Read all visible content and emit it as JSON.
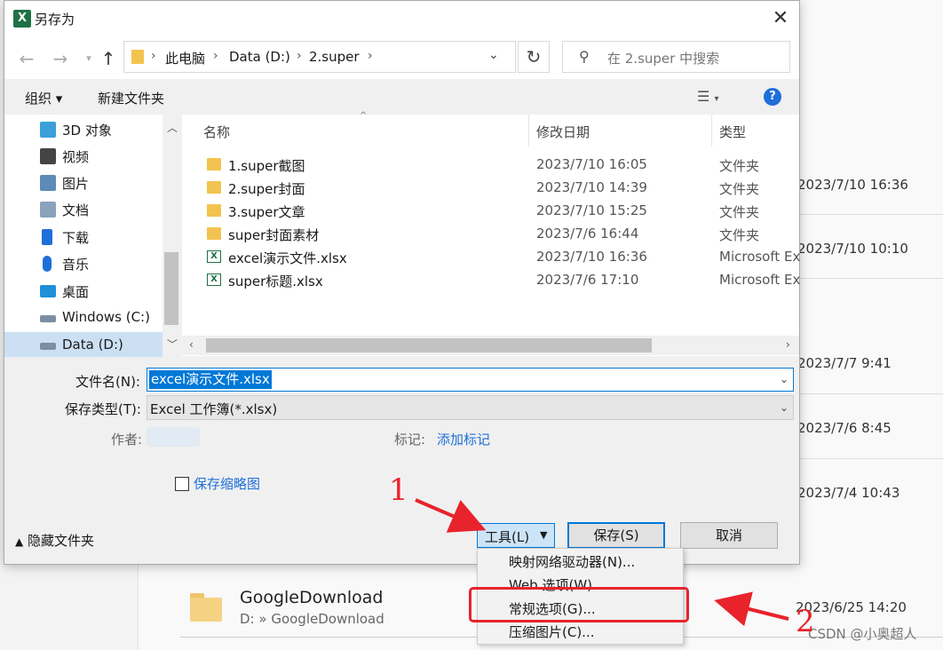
{
  "background": {
    "dates": [
      "2023/7/10 16:36",
      "2023/7/10 10:10",
      "2023/7/7 9:41",
      "2023/7/6 8:45",
      "2023/7/4 10:43"
    ],
    "folder": {
      "name": "GoogleDownload",
      "path": "D: » GoogleDownload",
      "date": "2023/6/25 14:20"
    },
    "watermark": "CSDN @小奥超人"
  },
  "dialog": {
    "title": "另存为",
    "title_icon": "X",
    "breadcrumb": [
      "此电脑",
      "Data (D:)",
      "2.super"
    ],
    "search_placeholder": "在 2.super 中搜索",
    "organize_label": "组织 ▾",
    "new_folder_label": "新建文件夹",
    "help_label": "?",
    "nav_items": [
      {
        "label": "3D 对象",
        "icon": "3d-objects-icon",
        "color": "#3aa0d8"
      },
      {
        "label": "视频",
        "icon": "video-icon",
        "color": "#444444"
      },
      {
        "label": "图片",
        "icon": "pictures-icon",
        "color": "#5d8ab6"
      },
      {
        "label": "文档",
        "icon": "documents-icon",
        "color": "#8aa2bb"
      },
      {
        "label": "下载",
        "icon": "downloads-icon",
        "color": "#1e6fd9"
      },
      {
        "label": "音乐",
        "icon": "music-icon",
        "color": "#1e6fd9"
      },
      {
        "label": "桌面",
        "icon": "desktop-icon",
        "color": "#1e90d9"
      },
      {
        "label": "Windows (C:)",
        "icon": "drive-c-icon",
        "color": "#7a8fa3"
      },
      {
        "label": "Data (D:)",
        "icon": "drive-d-icon",
        "color": "#7a8fa3"
      }
    ],
    "columns": {
      "name": "名称",
      "date": "修改日期",
      "type": "类型"
    },
    "files": [
      {
        "name": "1.super截图",
        "date": "2023/7/10 16:05",
        "type": "文件夹",
        "kind": "folder"
      },
      {
        "name": "2.super封面",
        "date": "2023/7/10 14:39",
        "type": "文件夹",
        "kind": "folder"
      },
      {
        "name": "3.super文章",
        "date": "2023/7/10 15:25",
        "type": "文件夹",
        "kind": "folder"
      },
      {
        "name": "super封面素材",
        "date": "2023/7/6 16:44",
        "type": "文件夹",
        "kind": "folder"
      },
      {
        "name": "excel演示文件.xlsx",
        "date": "2023/7/10 16:36",
        "type": "Microsoft Ex",
        "kind": "xlsx"
      },
      {
        "name": "super标题.xlsx",
        "date": "2023/7/6 17:10",
        "type": "Microsoft Ex",
        "kind": "xlsx"
      }
    ],
    "filename_label": "文件名(N):",
    "filename_value": "excel演示文件.xlsx",
    "filetype_label": "保存类型(T):",
    "filetype_value": "Excel 工作簿(*.xlsx)",
    "author_label": "作者:",
    "tags_label": "标记:",
    "tags_value": "添加标记",
    "thumbnail_label": "保存缩略图",
    "hide_folders_label": "隐藏文件夹",
    "tools_label": "工具(L)",
    "save_label": "保存(S)",
    "cancel_label": "取消"
  },
  "tools_menu": [
    "映射网络驱动器(N)...",
    "Web 选项(W)...",
    "常规选项(G)...",
    "压缩图片(C)..."
  ],
  "annotations": {
    "step1": "1",
    "step2": "2",
    "color": "#e8232c"
  }
}
